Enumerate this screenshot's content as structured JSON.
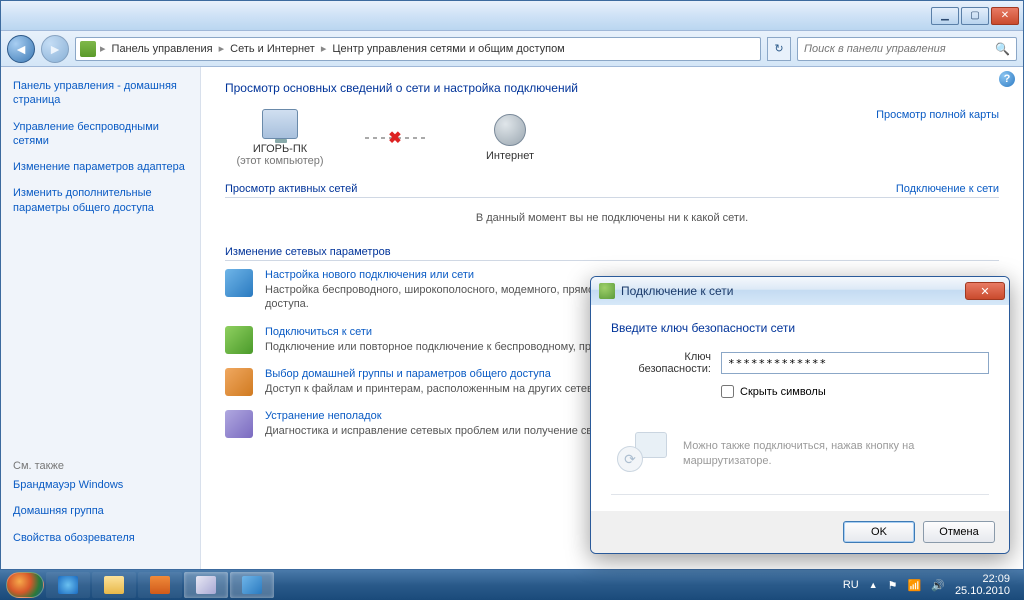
{
  "window_controls": {
    "min": "▁",
    "max": "▢",
    "close": "✕"
  },
  "breadcrumb": {
    "seg1": "Панель управления",
    "seg2": "Сеть и Интернет",
    "seg3": "Центр управления сетями и общим доступом"
  },
  "search_placeholder": "Поиск в панели управления",
  "sidebar": {
    "home": "Панель управления - домашняя страница",
    "link1": "Управление беспроводными сетями",
    "link2": "Изменение параметров адаптера",
    "link3": "Изменить дополнительные параметры общего доступа",
    "also_label": "См. также",
    "also1": "Брандмауэр Windows",
    "also2": "Домашняя группа",
    "also3": "Свойства обозревателя"
  },
  "content": {
    "title": "Просмотр основных сведений о сети и настройка подключений",
    "map_link": "Просмотр полной карты",
    "node_pc": "ИГОРЬ-ПК",
    "node_pc_sub": "(этот компьютер)",
    "node_internet": "Интернет",
    "active_title": "Просмотр активных сетей",
    "active_link": "Подключение к сети",
    "no_net": "В данный момент вы не подключены ни к какой сети.",
    "change_title": "Изменение сетевых параметров",
    "task1_title": "Настройка нового подключения или сети",
    "task1_desc": "Настройка беспроводного, широкополосного, модемного, прямого или VPN-подключения или же настройка маршрутизатора или точки доступа.",
    "task2_title": "Подключиться к сети",
    "task2_desc": "Подключение или повторное подключение к беспроводному, проводному, модемному сетевому соединению или подключение к VPN.",
    "task3_title": "Выбор домашней группы и параметров общего доступа",
    "task3_desc": "Доступ к файлам и принтерам, расположенным на других сетевых компьютерах, или изменение параметров общего доступа.",
    "task4_title": "Устранение неполадок",
    "task4_desc": "Диагностика и исправление сетевых проблем или получение сведений об исправлении."
  },
  "dialog": {
    "title": "Подключение к сети",
    "heading": "Введите ключ безопасности сети",
    "key_label": "Ключ безопасности:",
    "key_value": "*************",
    "hide_label": "Скрыть символы",
    "hint": "Можно также подключиться, нажав кнопку на маршрутизаторе.",
    "ok": "OK",
    "cancel": "Отмена"
  },
  "taskbar": {
    "lang": "RU",
    "time": "22:09",
    "date": "25.10.2010"
  }
}
